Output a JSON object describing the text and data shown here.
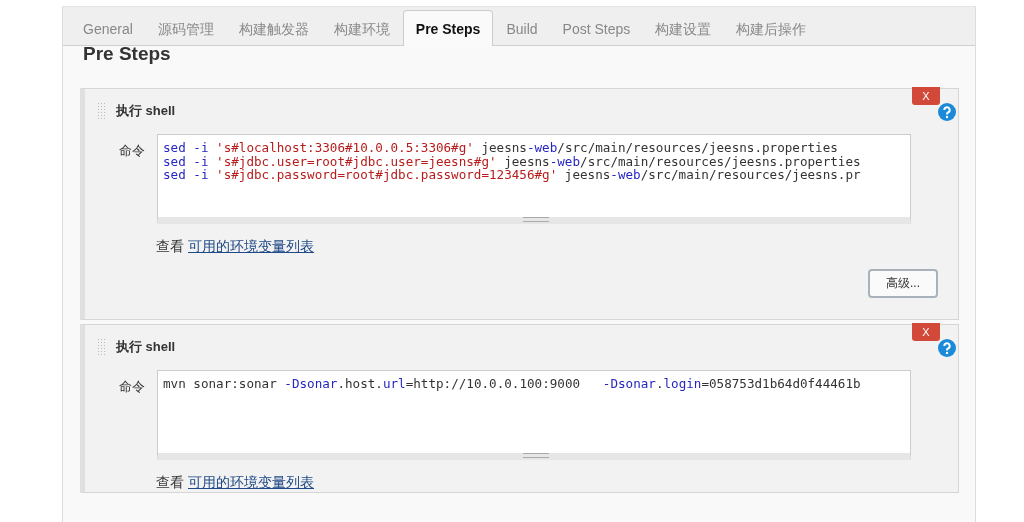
{
  "tabs": [
    {
      "label": "General",
      "selected": false
    },
    {
      "label": "源码管理",
      "selected": false
    },
    {
      "label": "构建触发器",
      "selected": false
    },
    {
      "label": "构建环境",
      "selected": false
    },
    {
      "label": "Pre Steps",
      "selected": true
    },
    {
      "label": "Build",
      "selected": false
    },
    {
      "label": "Post Steps",
      "selected": false
    },
    {
      "label": "构建设置",
      "selected": false
    },
    {
      "label": "构建后操作",
      "selected": false
    }
  ],
  "section_title": "Pre Steps",
  "steps": [
    {
      "title": "执行 shell",
      "delete_label": "X",
      "field_label": "命令",
      "command_lines": [
        [
          {
            "kind": "keyword",
            "text": "sed -i "
          },
          {
            "kind": "string",
            "text": "'s#localhost:3306#10.0.0.5:3306#g'"
          },
          {
            "kind": "plain",
            "text": " jeesns"
          },
          {
            "kind": "keyword",
            "text": "-web"
          },
          {
            "kind": "plain",
            "text": "/src/main/resources/jeesns.properties"
          }
        ],
        [
          {
            "kind": "keyword",
            "text": "sed -i "
          },
          {
            "kind": "string",
            "text": "'s#jdbc.user=root#jdbc.user=jeesns#g'"
          },
          {
            "kind": "plain",
            "text": " jeesns"
          },
          {
            "kind": "keyword",
            "text": "-web"
          },
          {
            "kind": "plain",
            "text": "/src/main/resources/jeesns.properties"
          }
        ],
        [
          {
            "kind": "keyword",
            "text": "sed -i "
          },
          {
            "kind": "string",
            "text": "'s#jdbc.password=root#jdbc.password=123456#g'"
          },
          {
            "kind": "plain",
            "text": " jeesns"
          },
          {
            "kind": "keyword",
            "text": "-web"
          },
          {
            "kind": "plain",
            "text": "/src/main/resources/jeesns.pr"
          }
        ]
      ],
      "env_prefix": "查看",
      "env_link": "可用的环境变量列表",
      "advanced_button": "高级..."
    },
    {
      "title": "执行 shell",
      "delete_label": "X",
      "field_label": "命令",
      "command_lines": [
        [
          {
            "kind": "plain",
            "text": "mvn sonar:sonar "
          },
          {
            "kind": "keyword",
            "text": "-Dsonar"
          },
          {
            "kind": "plain",
            "text": ".host."
          },
          {
            "kind": "keyword",
            "text": "url"
          },
          {
            "kind": "plain",
            "text": "=http://10.0.0.100:9000   "
          },
          {
            "kind": "keyword",
            "text": "-Dsonar"
          },
          {
            "kind": "plain",
            "text": "."
          },
          {
            "kind": "keyword",
            "text": "login"
          },
          {
            "kind": "plain",
            "text": "=058753d1b64d0f44461b"
          }
        ]
      ],
      "env_prefix": "查看",
      "env_link": "可用的环境变量列表"
    }
  ]
}
